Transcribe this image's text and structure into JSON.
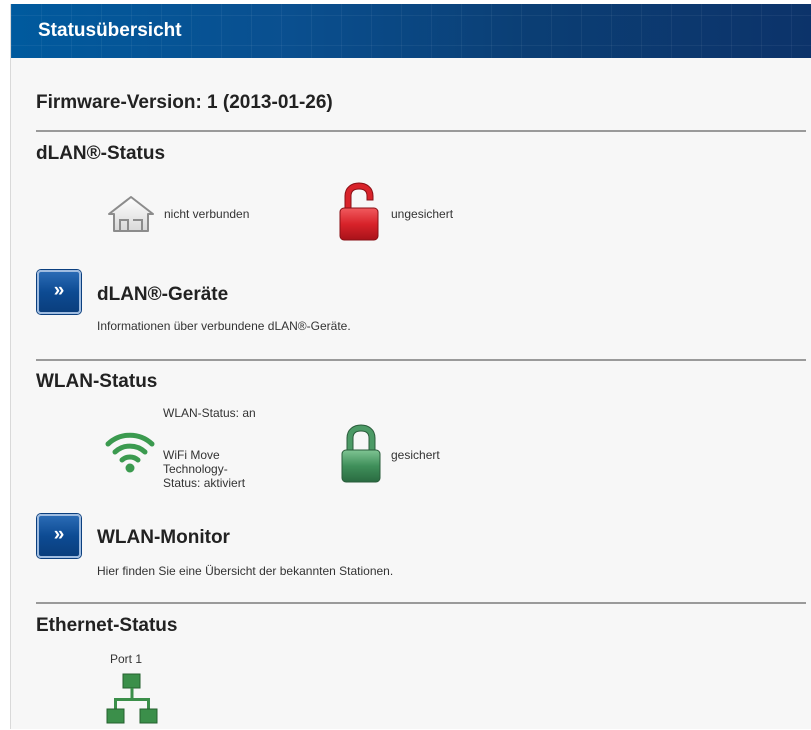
{
  "header": {
    "title": "Statusübersicht"
  },
  "firmware": {
    "label": "Firmware-Version: 1 (2013-01-26)"
  },
  "dlan_status": {
    "title": "dLAN®-Status",
    "connection_text": "nicht verbunden",
    "connection_icon": "house-icon",
    "security_text": "ungesichert",
    "security_icon": "lock-open-icon",
    "security_color": "#d8232a"
  },
  "dlan_devices": {
    "button_label": "»",
    "title": "dLAN®-Geräte",
    "description": "Informationen über verbundene dLAN®-Geräte."
  },
  "wlan_status": {
    "title": "WLAN-Status",
    "status_text": "WLAN-Status: an",
    "wifi_move_lines": [
      "WiFi Move",
      "Technology-",
      "Status: aktiviert"
    ],
    "wifi_icon": "wifi-icon",
    "wifi_color": "#3b9a4f",
    "security_text": "gesichert",
    "security_icon": "lock-closed-icon",
    "security_color": "#3f8f5a"
  },
  "wlan_monitor": {
    "button_label": "»",
    "title": "WLAN-Monitor",
    "description": "Hier finden Sie eine Übersicht der bekannten Stationen."
  },
  "ethernet_status": {
    "title": "Ethernet-Status",
    "port_label": "Port 1",
    "port_icon": "network-icon",
    "port_color": "#3b8f4a"
  }
}
